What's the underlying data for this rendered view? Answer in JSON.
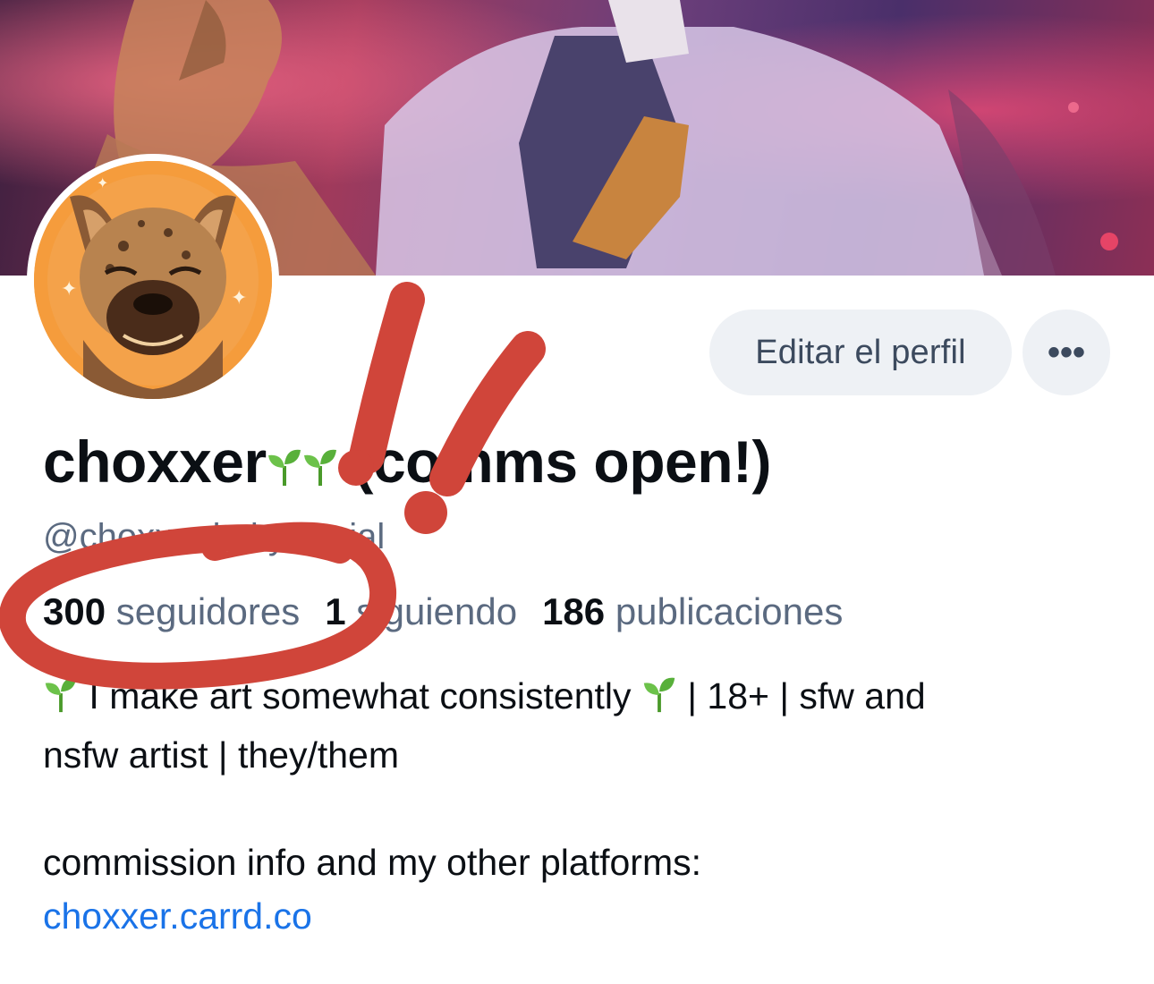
{
  "profile": {
    "display_name_prefix": "choxxer",
    "display_name_suffix": "(comms open!)",
    "handle": "@choxxer.bsky.social",
    "edit_button": "Editar el perfil",
    "more_button": "•••"
  },
  "stats": {
    "followers_count": "300",
    "followers_label": "seguidores",
    "following_count": "1",
    "following_label": "siguiendo",
    "posts_count": "186",
    "posts_label": "publicaciones"
  },
  "bio": {
    "line1_a": "I make art somewhat consistently",
    "line1_b": "| 18+ | sfw and",
    "line2": "nsfw artist | they/them",
    "line3": "commission info and my other platforms:",
    "link": "choxxer.carrd.co"
  },
  "icons": {
    "sprout": "seedling-icon",
    "more": "ellipsis-icon"
  },
  "colors": {
    "link": "#1a73e8",
    "muted": "#5b6a80",
    "button_bg": "#eef1f5",
    "markup_red": "#d0453a",
    "avatar_bg": "#f59c3c"
  }
}
